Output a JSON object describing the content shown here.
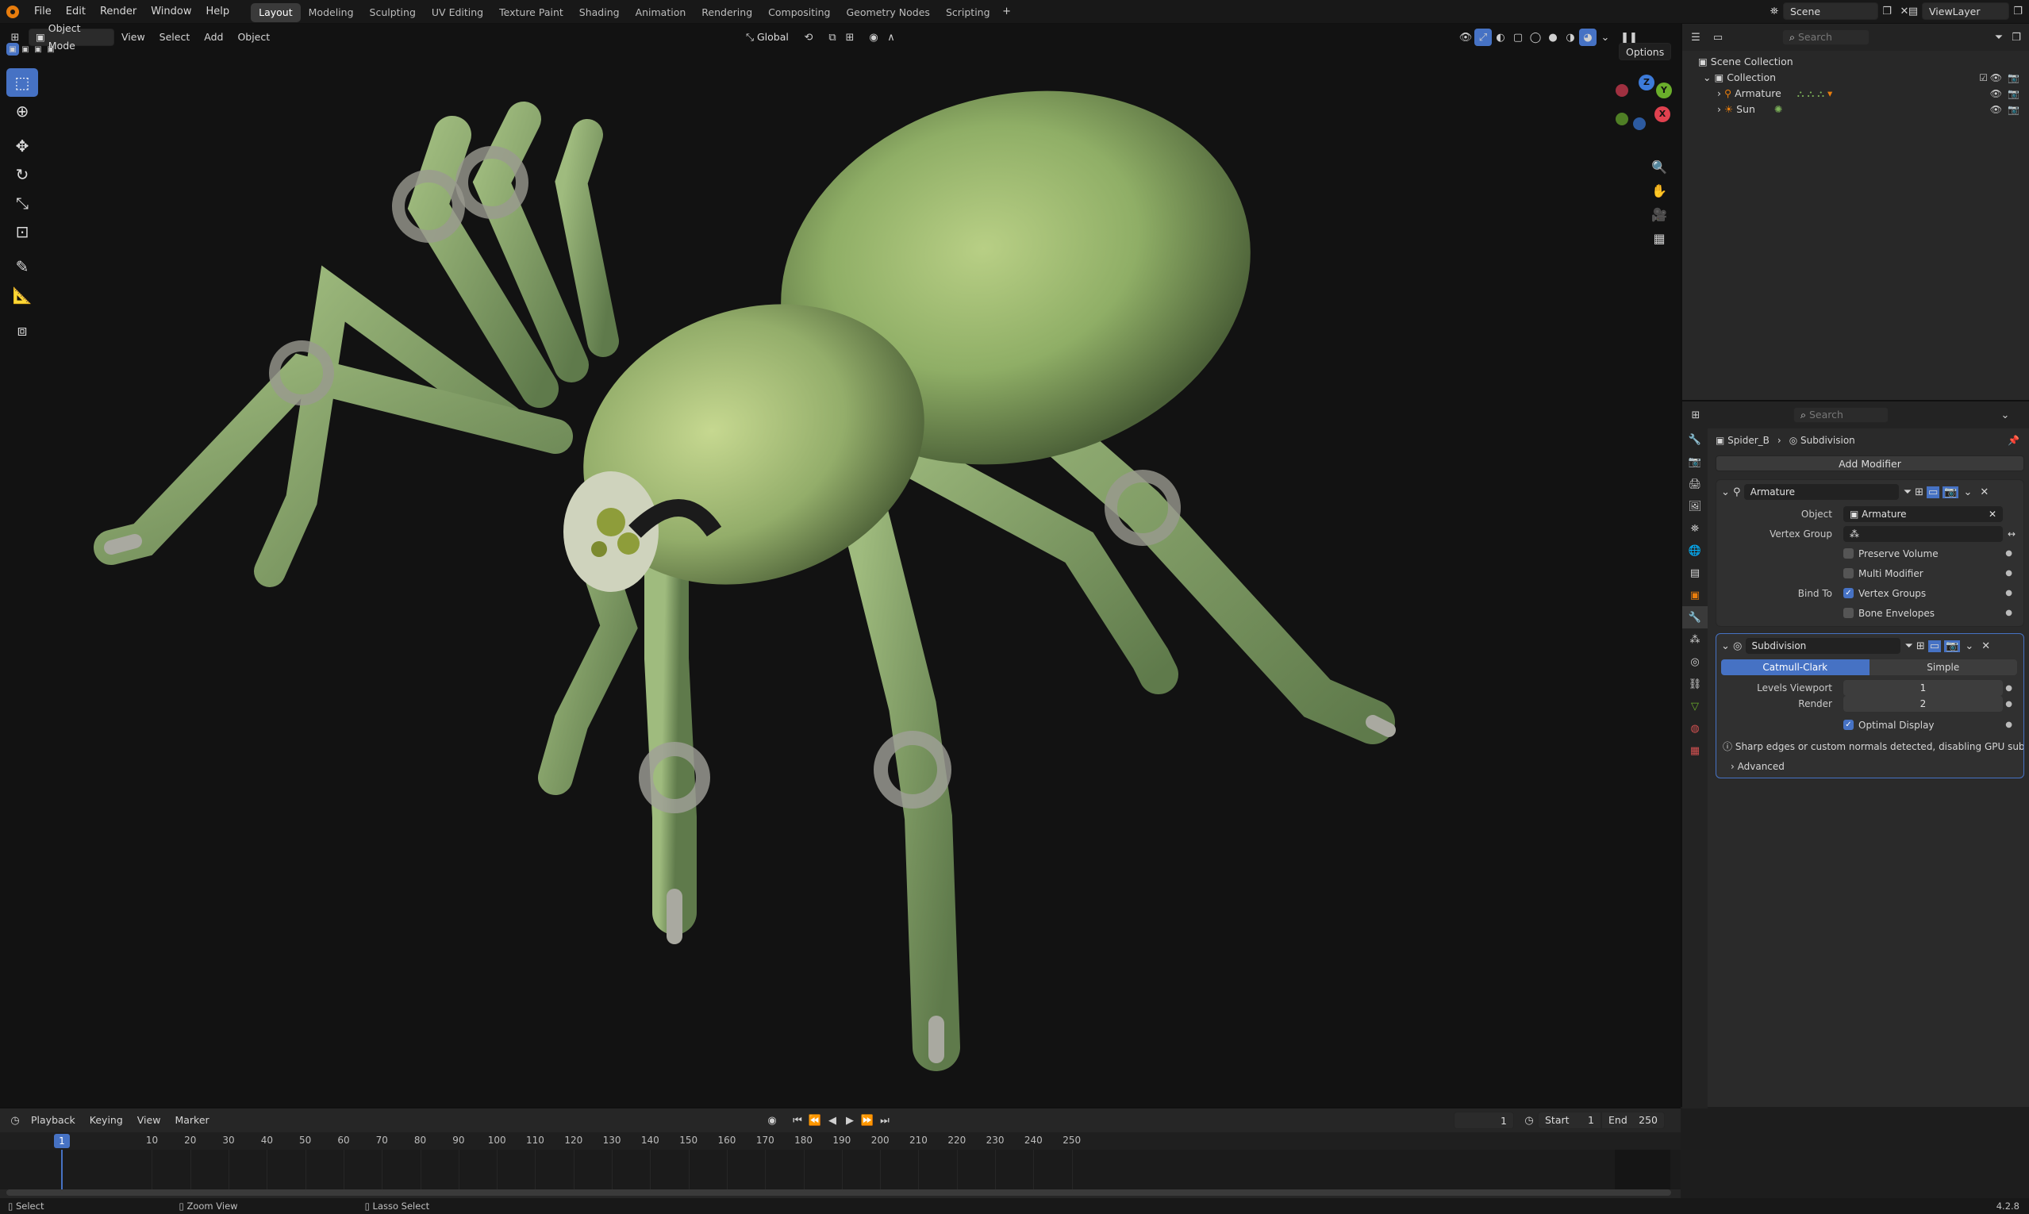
{
  "menus": [
    "File",
    "Edit",
    "Render",
    "Window",
    "Help"
  ],
  "workspaces": [
    "Layout",
    "Modeling",
    "Sculpting",
    "UV Editing",
    "Texture Paint",
    "Shading",
    "Animation",
    "Rendering",
    "Compositing",
    "Geometry Nodes",
    "Scripting"
  ],
  "active_workspace": "Layout",
  "scene_name": "Scene",
  "view_layer": "ViewLayer",
  "viewport": {
    "mode": "Object Mode",
    "menus": [
      "View",
      "Select",
      "Add",
      "Object"
    ],
    "transform_orientation": "Global",
    "options_label": "Options",
    "gizmo_axes": {
      "x": "X",
      "y": "Y",
      "z": "Z"
    }
  },
  "outliner": {
    "search_placeholder": "Search",
    "scene_collection": "Scene Collection",
    "collection": "Collection",
    "items": [
      "Armature",
      "Sun"
    ]
  },
  "properties": {
    "search_placeholder": "Search",
    "breadcrumb_object": "Spider_B",
    "breadcrumb_modifier": "Subdivision",
    "add_modifier": "Add Modifier",
    "armature_mod": {
      "name": "Armature",
      "object_label": "Object",
      "object_value": "Armature",
      "vertex_group_label": "Vertex Group",
      "preserve_volume": "Preserve Volume",
      "multi_modifier": "Multi Modifier",
      "bind_to_label": "Bind To",
      "vertex_groups": "Vertex Groups",
      "bone_envelopes": "Bone Envelopes"
    },
    "subdivision_mod": {
      "name": "Subdivision",
      "type_catmull": "Catmull-Clark",
      "type_simple": "Simple",
      "levels_viewport_label": "Levels Viewport",
      "levels_viewport": "1",
      "render_label": "Render",
      "render_value": "2",
      "optimal_display": "Optimal Display",
      "warning": "Sharp edges or custom normals detected, disabling GPU subdivi...",
      "advanced": "Advanced"
    }
  },
  "timeline": {
    "menus": [
      "Playback",
      "Keying",
      "View",
      "Marker"
    ],
    "current_frame": "1",
    "start_label": "Start",
    "start": "1",
    "end_label": "End",
    "end": "250",
    "ticks": [
      "10",
      "20",
      "30",
      "40",
      "50",
      "60",
      "70",
      "80",
      "90",
      "100",
      "110",
      "120",
      "130",
      "140",
      "150",
      "160",
      "170",
      "180",
      "190",
      "200",
      "210",
      "220",
      "230",
      "240",
      "250"
    ],
    "playhead_label": "1"
  },
  "status": {
    "select": "Select",
    "zoom_view": "Zoom View",
    "lasso_select": "Lasso Select",
    "version": "4.2.8"
  },
  "colors": {
    "accent": "#4672c4",
    "orange": "#e87d0d",
    "axis_x": "#e0414f",
    "axis_y": "#6aae2b",
    "axis_z": "#3d7bd9"
  }
}
